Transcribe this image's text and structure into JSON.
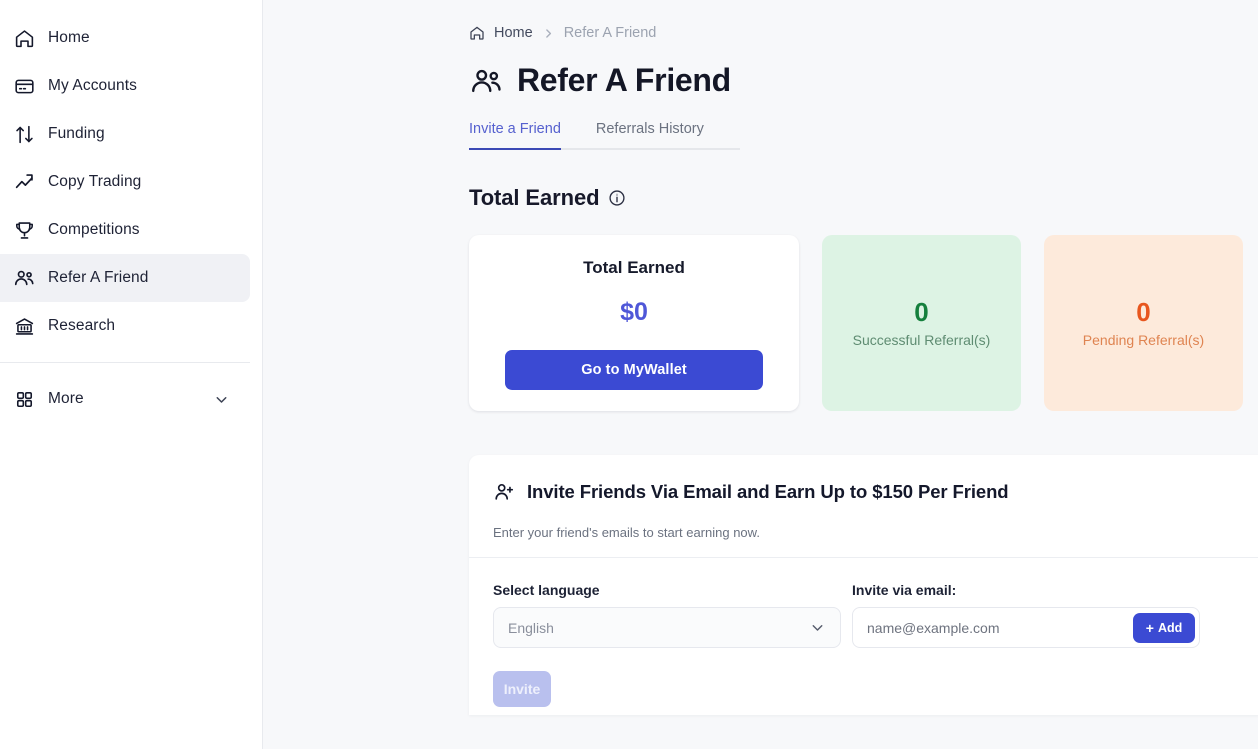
{
  "sidebar": {
    "items": [
      {
        "label": "Home",
        "icon": "home-icon",
        "active": false
      },
      {
        "label": "My Accounts",
        "icon": "credit-card-icon",
        "active": false
      },
      {
        "label": "Funding",
        "icon": "arrows-up-down-icon",
        "active": false
      },
      {
        "label": "Copy Trading",
        "icon": "trend-up-icon",
        "active": false
      },
      {
        "label": "Competitions",
        "icon": "trophy-icon",
        "active": false
      },
      {
        "label": "Refer A Friend",
        "icon": "people-group-icon",
        "active": true
      },
      {
        "label": "Research",
        "icon": "bank-icon",
        "active": false
      }
    ],
    "more": {
      "label": "More",
      "icon": "grid-dots-icon",
      "chevron": "chevron-down-icon"
    }
  },
  "breadcrumb": {
    "home_icon": "home-icon",
    "home": "Home",
    "separator": "›",
    "current": "Refer A Friend"
  },
  "header": {
    "title": "Refer A Friend",
    "title_icon": "people-group-icon"
  },
  "tabs": [
    {
      "label": "Invite a Friend",
      "active": true
    },
    {
      "label": "Referrals History",
      "active": false
    }
  ],
  "total_earned_section": {
    "heading": "Total Earned",
    "info_icon": "info-circle-icon"
  },
  "cards": {
    "total": {
      "label": "Total Earned",
      "value": "$0",
      "button_label": "Go to MyWallet",
      "value_color": "#4f57d8",
      "button_color": "#3b4ad3"
    },
    "successful": {
      "value": "0",
      "label": "Successful Referral(s)",
      "bg_color": "#ddf3e4",
      "value_color": "#15803d"
    },
    "pending": {
      "value": "0",
      "label": "Pending Referral(s)",
      "bg_color": "#fdeadb",
      "value_color": "#e8561e"
    }
  },
  "invite_panel": {
    "icon": "user-plus-icon",
    "title": "Invite Friends Via Email and Earn Up to $150 Per Friend",
    "subtitle": "Enter your friend's emails to start earning now.",
    "language": {
      "label": "Select language",
      "value": "English",
      "chevron_icon": "chevron-down-icon"
    },
    "email": {
      "label": "Invite via email:",
      "value": "",
      "placeholder": "name@example.com",
      "add_button": "Add",
      "add_icon": "plus-icon"
    },
    "invite_button": "Invite"
  }
}
